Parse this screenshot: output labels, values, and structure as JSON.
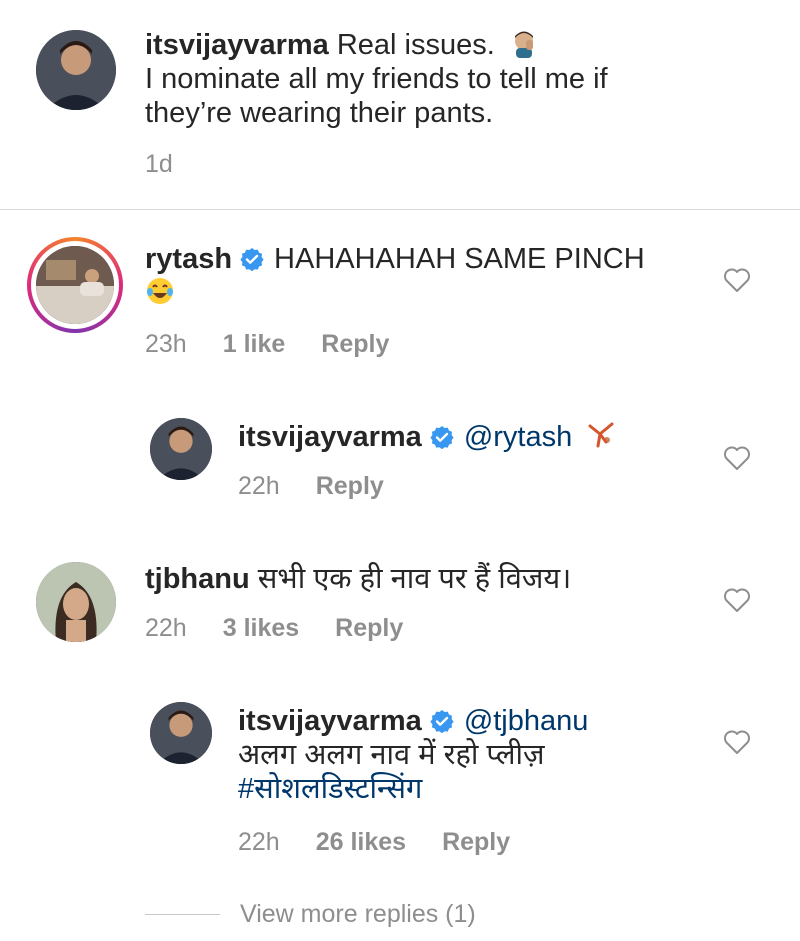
{
  "caption": {
    "username": "itsvijayvarma",
    "line1": "Real issues.",
    "line2": "I nominate all my friends to tell me if",
    "line3": "they’re wearing their pants.",
    "time": "1d"
  },
  "comments": [
    {
      "username": "rytash",
      "text": "HAHAHAHAH SAME PINCH",
      "time": "23h",
      "likes": "1 like",
      "reply": "Reply"
    },
    {
      "username": "itsvijayvarma",
      "mention": "@rytash",
      "time": "22h",
      "reply": "Reply"
    },
    {
      "username": "tjbhanu",
      "text": "सभी एक ही नाव पर हैं विजय।",
      "time": "22h",
      "likes": "3 likes",
      "reply": "Reply"
    },
    {
      "username": "itsvijayvarma",
      "mention": "@tjbhanu",
      "line2": "अलग अलग नाव में रहो प्लीज़",
      "hashtag": "#सोशलडिस्टन्सिंग",
      "time": "22h",
      "likes": "26 likes",
      "reply": "Reply"
    }
  ],
  "view_more": "View more replies (1)",
  "icons": {
    "like": "heart-outline-icon",
    "verified": "verified-badge-icon"
  },
  "colors": {
    "verified": "#3897f0",
    "link": "#00376b",
    "muted": "#8e8e8e"
  }
}
